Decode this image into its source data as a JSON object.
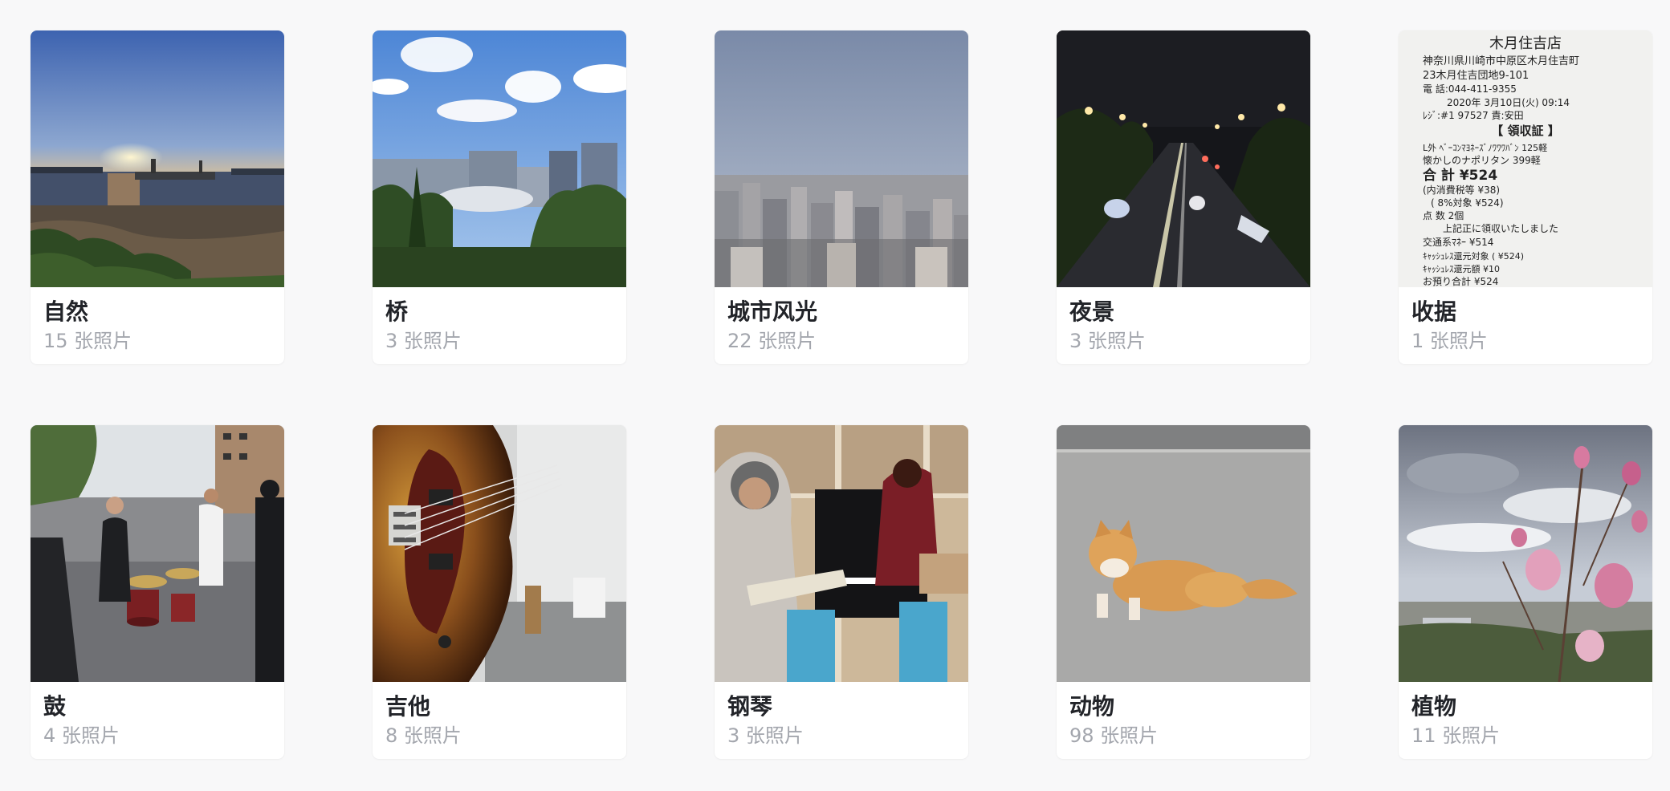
{
  "albums": [
    {
      "name": "自然",
      "count": "15",
      "unit": "张照片",
      "thumbnail": "sunset-over-harbor"
    },
    {
      "name": "桥",
      "count": "3",
      "unit": "张照片",
      "thumbnail": "buildings-under-blue-sky"
    },
    {
      "name": "城市风光",
      "count": "22",
      "unit": "张照片",
      "thumbnail": "city-skyline"
    },
    {
      "name": "夜景",
      "count": "3",
      "unit": "张照片",
      "thumbnail": "highway-at-night"
    },
    {
      "name": "收据",
      "count": "1",
      "unit": "张照片",
      "thumbnail": "paper-receipt",
      "receipt_text": [
        "木月住吉店",
        "神奈川県川崎市中原区木月住吉町",
        "23木月住吉団地9-101",
        "電 話:044-411-9355",
        "2020年 3月10日(火) 09:14",
        "ﾚｼﾞ:#1 97527    責:安田",
        "【 領収証 】",
        "L外 ﾍﾞｰｺﾝﾏﾖﾈｰｽﾞﾉﾜﾜﾜﾊﾞﾝ   125軽",
        "懐かしのナポリタン        399軽",
        "合  計         ¥524",
        "(内消費税等           ¥38)",
        "( 8%対象           ¥524)",
        "点   数            2個",
        "上記正に領収いたしました",
        "交通系ﾏﾈｰ            ¥514",
        "ｷｬｯｼｭﾚｽ還元対象  (    ¥524)",
        "ｷｬｯｼｭﾚｽ還元額        ¥10",
        "お預り合計           ¥524"
      ]
    },
    {
      "name": "鼓",
      "count": "4",
      "unit": "张照片",
      "thumbnail": "drummer-outdoors"
    },
    {
      "name": "吉他",
      "count": "8",
      "unit": "张照片",
      "thumbnail": "bass-guitar-closeup"
    },
    {
      "name": "钢琴",
      "count": "3",
      "unit": "张照片",
      "thumbnail": "guitarist-and-pianist"
    },
    {
      "name": "动物",
      "count": "98",
      "unit": "张照片",
      "thumbnail": "orange-cat"
    },
    {
      "name": "植物",
      "count": "11",
      "unit": "张照片",
      "thumbnail": "magnolia-blossoms"
    }
  ]
}
